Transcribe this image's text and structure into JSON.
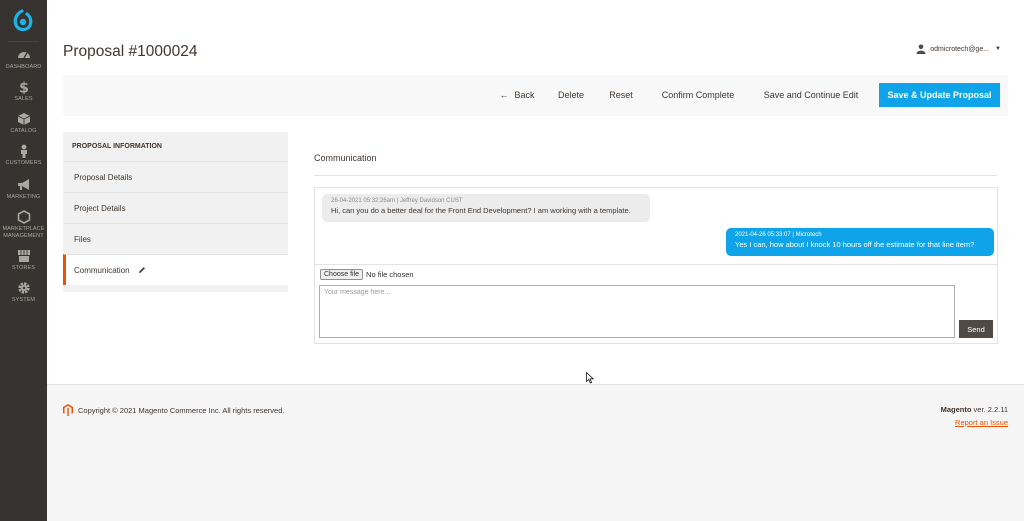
{
  "menu": {
    "items": [
      {
        "label": "DASHBOARD",
        "icon": "dashboard-icon"
      },
      {
        "label": "SALES",
        "icon": "dollar-icon"
      },
      {
        "label": "CATALOG",
        "icon": "box-icon"
      },
      {
        "label": "CUSTOMERS",
        "icon": "person-icon"
      },
      {
        "label": "MARKETING",
        "icon": "megaphone-icon"
      },
      {
        "label": "MARKETPLACE",
        "label2": "MANAGEMENT",
        "icon": "hexagon-icon"
      },
      {
        "label": "STORES",
        "icon": "store-icon"
      },
      {
        "label": "SYSTEM",
        "icon": "gear-icon"
      }
    ]
  },
  "header": {
    "title": "Proposal #1000024",
    "user": "odmicrotech@ge..."
  },
  "actions": {
    "back": "Back",
    "delete": "Delete",
    "reset": "Reset",
    "confirm": "Confirm Complete",
    "save_continue": "Save and Continue Edit",
    "save_update": "Save & Update Proposal"
  },
  "tabs": {
    "heading": "PROPOSAL INFORMATION",
    "items": [
      "Proposal Details",
      "Project Details",
      "Files",
      "Communication"
    ]
  },
  "communication": {
    "title": "Communication",
    "messages": [
      {
        "meta": "26-04-2021 05:32:26am | Jeffrey Davidson CUST",
        "text": "Hi, can you do a better deal for the Front End Development? I am working with a template."
      },
      {
        "meta": "2021-04-26 05:33:07 | Microtech",
        "text": "Yes I can, how about I knock 10 hours off the estimate for that line item?"
      }
    ],
    "file_button": "Choose file",
    "file_status": "No file chosen",
    "placeholder": "Your message here...",
    "send": "Send"
  },
  "footer": {
    "copyright": "Copyright © 2021 Magento Commerce Inc. All rights reserved.",
    "brand": "Magento",
    "version": "ver. 2.2.11",
    "report": "Report an Issue"
  },
  "colors": {
    "accent": "#0fa4ea",
    "menu_bg": "#373330",
    "active_tab": "#eb5202"
  }
}
